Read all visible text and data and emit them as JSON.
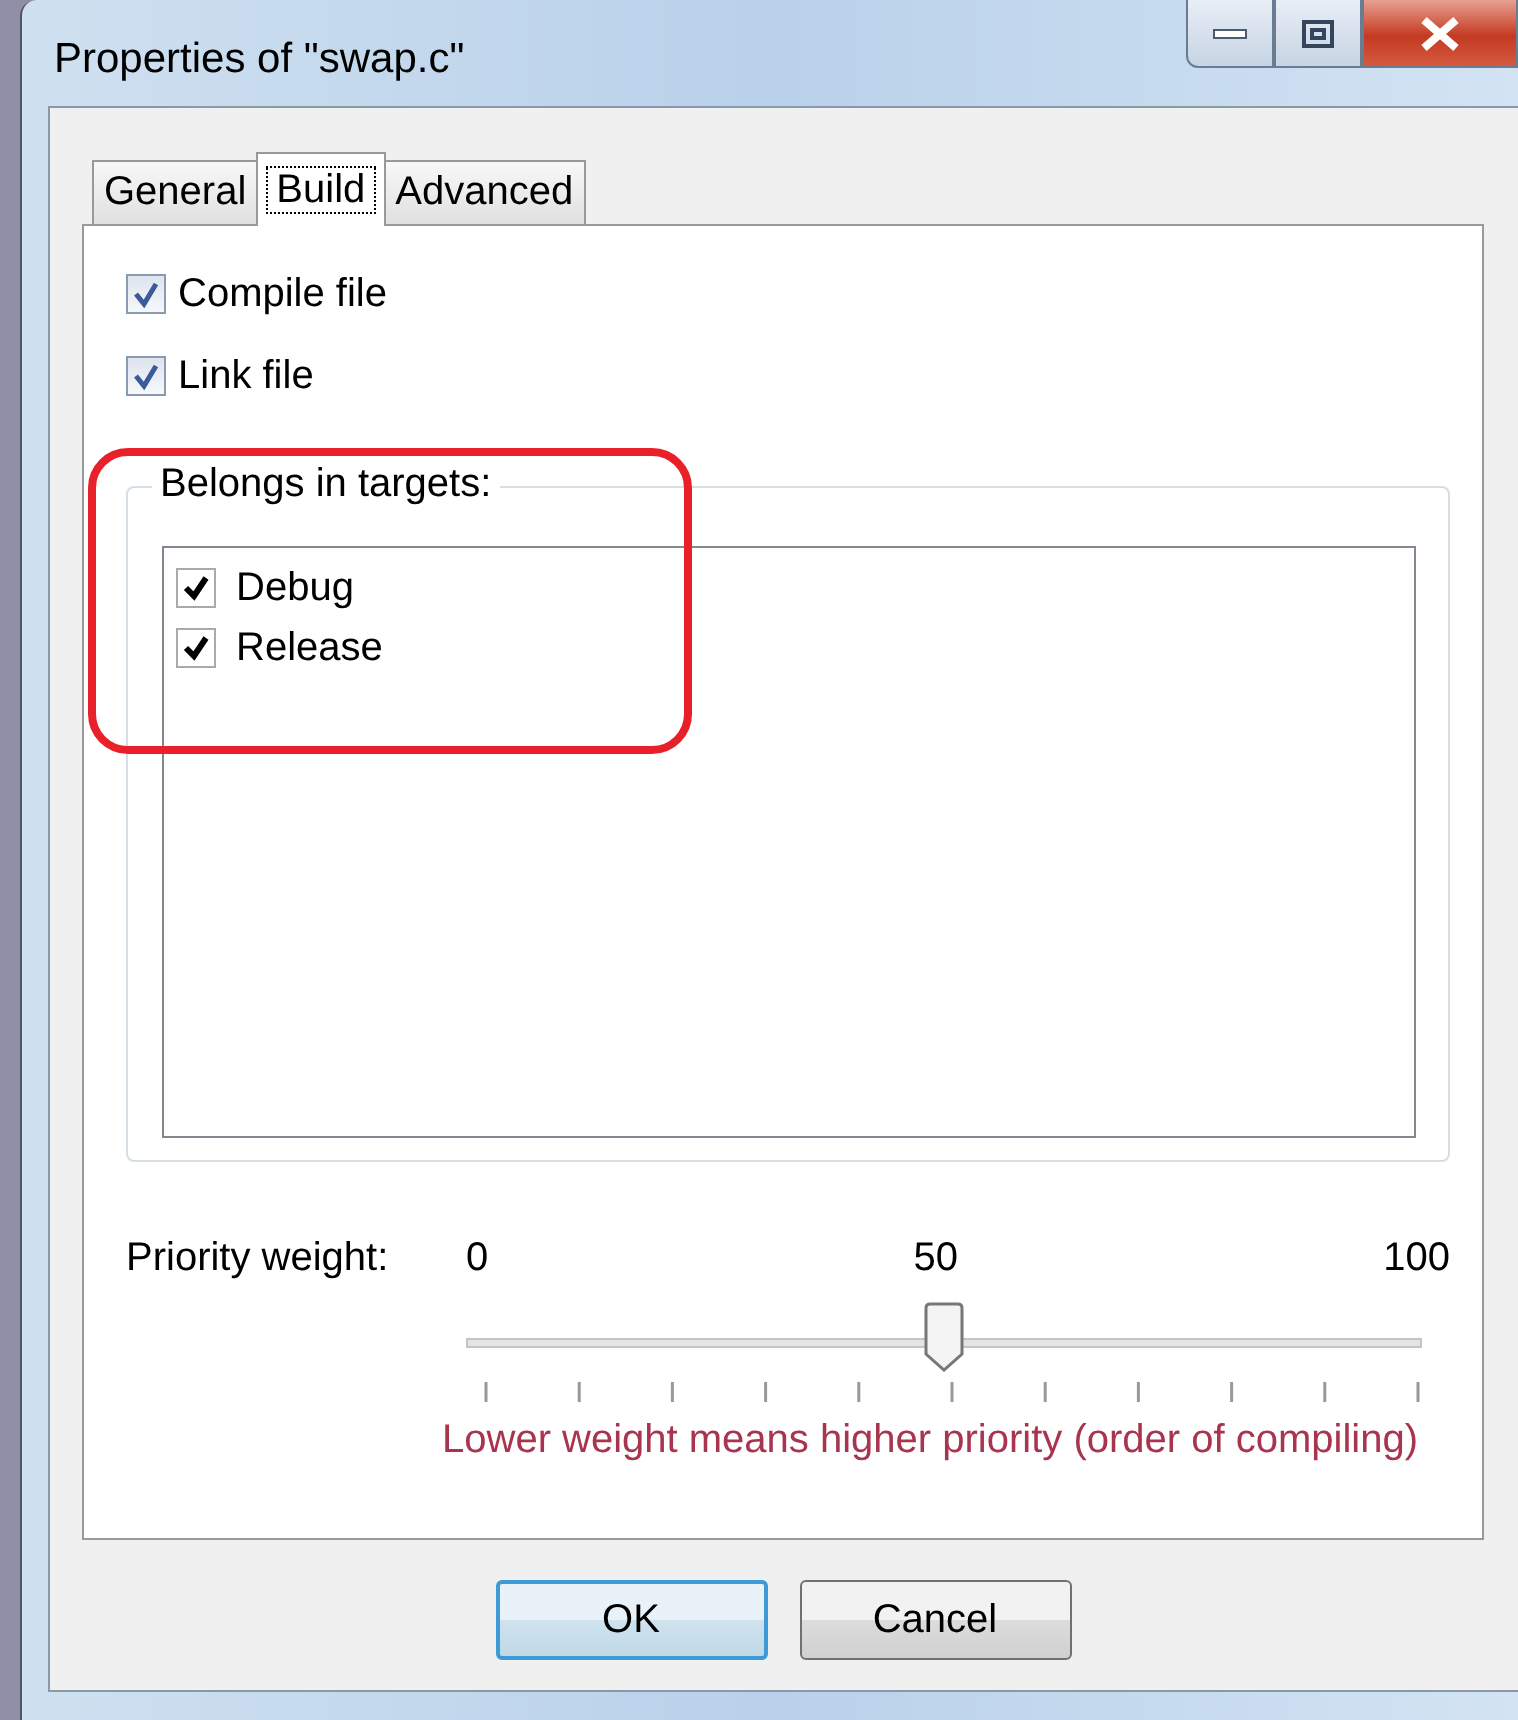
{
  "window": {
    "title": "Properties of \"swap.c\""
  },
  "tabs": [
    {
      "label": "General",
      "selected": false
    },
    {
      "label": "Build",
      "selected": true
    },
    {
      "label": "Advanced",
      "selected": false
    }
  ],
  "options": [
    {
      "label": "Compile file",
      "checked": true
    },
    {
      "label": "Link file",
      "checked": true
    }
  ],
  "targets": {
    "title": "Belongs in targets:",
    "items": [
      {
        "label": "Debug",
        "checked": true
      },
      {
        "label": "Release",
        "checked": true
      }
    ]
  },
  "priority": {
    "label": "Priority weight:",
    "min": "0",
    "mid": "50",
    "max": "100",
    "level": 0.5,
    "hint": "Lower weight means higher priority (order of compiling)"
  },
  "buttons": [
    {
      "label": "OK",
      "default": true
    },
    {
      "label": "Cancel",
      "default": false
    }
  ]
}
